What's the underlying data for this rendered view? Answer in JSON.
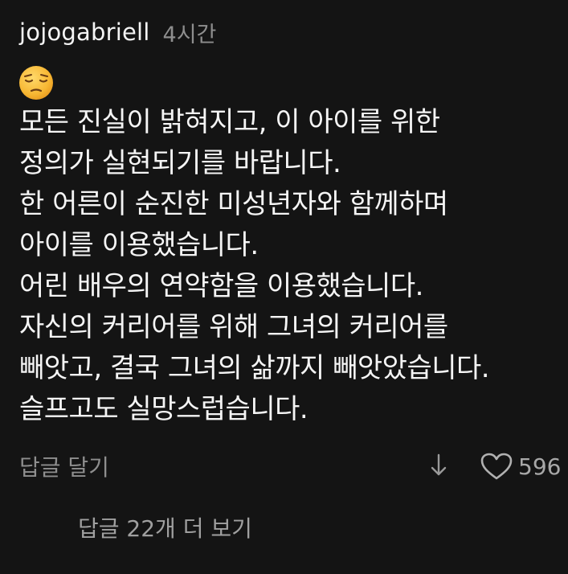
{
  "comment": {
    "username": "jojogabriell",
    "timestamp": "4시간",
    "emoji": "pensive-face",
    "lines": [
      "모든 진실이 밝혀지고, 이 아이를 위한",
      "정의가 실현되기를 바랍니다.",
      "한 어른이 순진한 미성년자와 함께하며",
      "아이를 이용했습니다.",
      "어린 배우의 연약함을 이용했습니다.",
      "자신의 커리어를 위해 그녀의 커리어를",
      "빼앗고, 결국 그녀의 삶까지 빼앗았습니다.",
      "슬프고도 실망스럽습니다."
    ]
  },
  "actions": {
    "reply_label": "답글 달기",
    "dislike_icon": "arrow-down-icon",
    "like_icon": "heart-outline-icon",
    "like_count": "596"
  },
  "replies": {
    "more_label": "답글 22개 더 보기"
  },
  "colors": {
    "background": "#141414",
    "primary_text": "#f5f5f5",
    "secondary_text": "#8e8e8e",
    "emoji_face": "#f7b733"
  }
}
